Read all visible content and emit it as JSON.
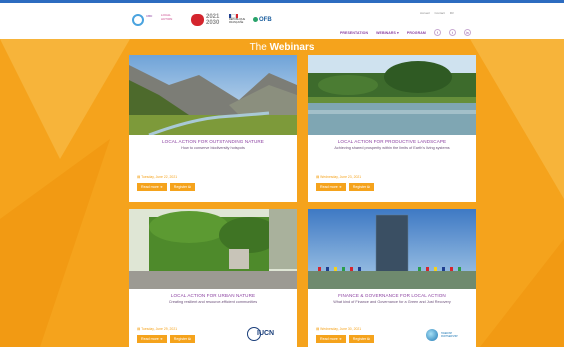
{
  "header": {
    "utility_links": [
      "Accueil",
      "Contact",
      "FR"
    ],
    "nav_items": [
      "PRESENTATION",
      "WEBINARS ▾",
      "PROGRAM"
    ],
    "social": [
      "f",
      "t",
      "in"
    ],
    "logos": {
      "logo_1": "CBD",
      "logo_2": "LOCAL ACTION",
      "logo_3": "",
      "logo_4_top": "2021",
      "logo_4_bottom": "2030",
      "logo_5": "RÉPUBLIQUE FRANÇAISE",
      "logo_6": "OFB"
    }
  },
  "section": {
    "title_prefix": "The ",
    "title_bold": "Webinars"
  },
  "cards": [
    {
      "title": "LOCAL ACTION FOR OUTSTANDING NATURE",
      "subtitle": "How to conserve biodiversity hotspots",
      "date": "▤ Tuesday, June 22, 2021",
      "read_more": "Read more ➔",
      "register": "Register ⧉"
    },
    {
      "title": "LOCAL ACTION FOR PRODUCTIVE LANDSCAPE",
      "subtitle": "Achieving shared prosperity within the limits of Earth's living systems",
      "date": "▤ Wednesday, June 23, 2021",
      "read_more": "Read more ➔",
      "register": "Register ⧉"
    },
    {
      "title": "LOCAL ACTION FOR URBAN NATURE",
      "subtitle": "Creating resilient and resource-efficient communities",
      "date": "▤ Tuesday, June 29, 2021",
      "read_more": "Read more ➔",
      "register": "Register ⧉",
      "partner": "IUCN"
    },
    {
      "title": "FINANCE & GOVERNANCE FOR LOCAL ACTION",
      "subtitle": "What kind of Finance and Governance for a Green and Just Recovery",
      "date": "▤ Wednesday, June 30, 2021",
      "read_more": "Read more ➔",
      "register": "Register ⧉",
      "partner": "SWEDISH PARTNERSHIP"
    }
  ],
  "colors": {
    "accent": "#f5a31c",
    "purple": "#8a3fa0",
    "top_strip": "#2d6cc0"
  }
}
